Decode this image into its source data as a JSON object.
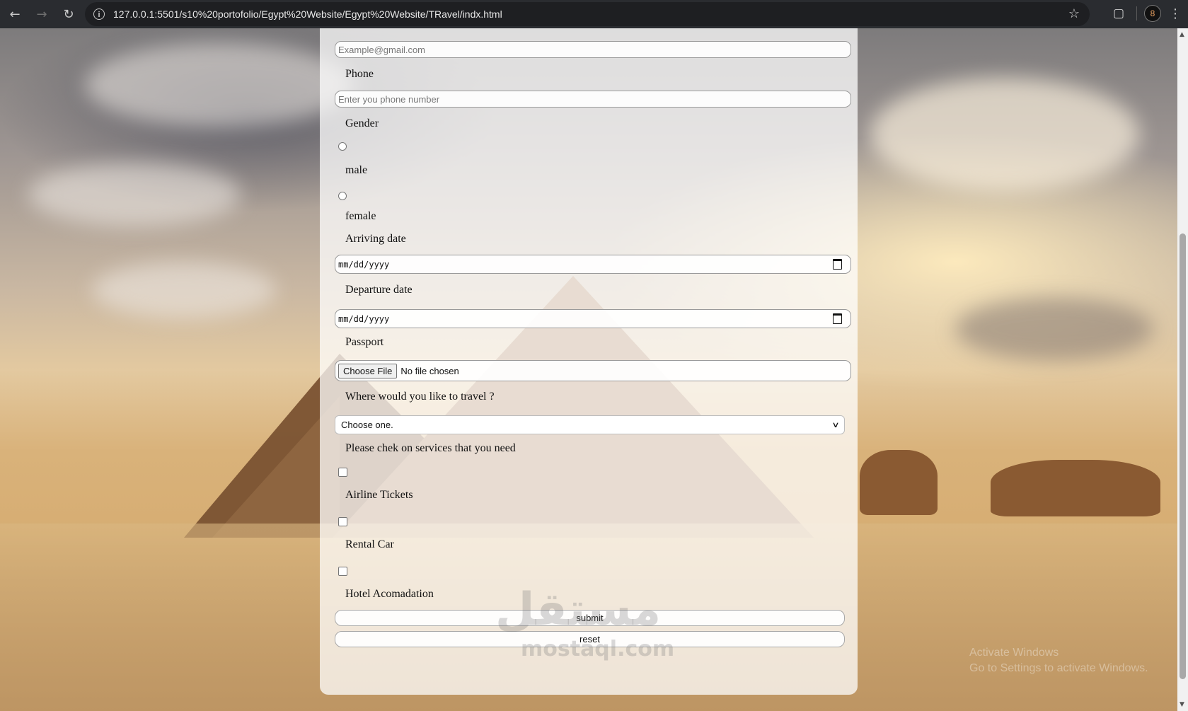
{
  "browser": {
    "url": "127.0.0.1:5501/s10%20portofolio/Egypt%20Website/Egypt%20Website/TRavel/indx.html",
    "profile_initial": "8"
  },
  "form": {
    "email_placeholder": "Example@gmail.com",
    "phone_label": "Phone",
    "phone_placeholder": "Enter you phone number",
    "gender_label": "Gender",
    "gender_options": [
      "male",
      "female"
    ],
    "arriving_label": "Arriving date",
    "arriving_value": "mm/dd/yyyy",
    "departure_label": "Departure date",
    "departure_value": "mm/dd/yyyy",
    "passport_label": "Passport",
    "file_button": "Choose File",
    "file_status": "No file chosen",
    "travel_label": "Where would you like to travel ?",
    "travel_selected": "Choose one.",
    "services_label": "Please chek on services that you need",
    "services": [
      "Airline Tickets",
      "Rental Car",
      "Hotel Acomadation"
    ],
    "submit_label": "submit",
    "reset_label": "reset"
  },
  "watermark": {
    "arabic": "مستقل",
    "latin": "mostaql.com"
  },
  "os_overlay": {
    "line1": "Activate Windows",
    "line2": "Go to Settings to activate Windows."
  }
}
